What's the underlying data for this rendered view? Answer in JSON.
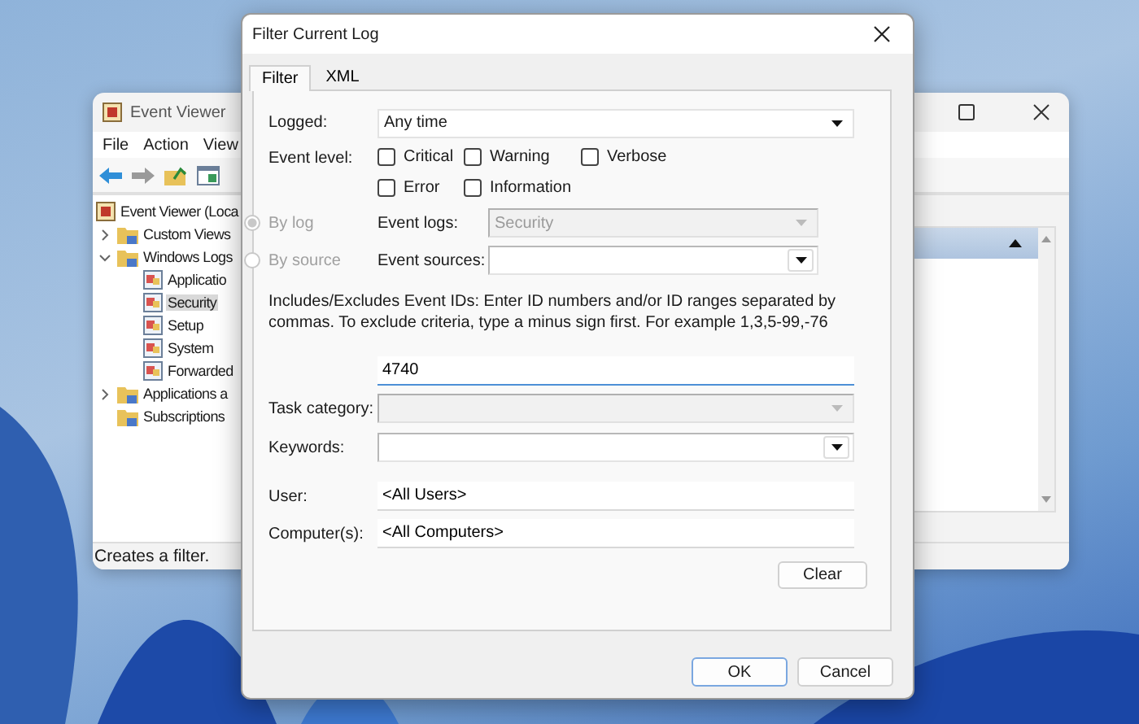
{
  "event_viewer": {
    "title": "Event Viewer",
    "menu": [
      {
        "label": "File"
      },
      {
        "label": "Action"
      },
      {
        "label": "View"
      }
    ],
    "tree": [
      {
        "label": "Event Viewer (Loca",
        "selected": false,
        "children": [
          {
            "label": "Custom Views",
            "selected": false,
            "expanded": false
          },
          {
            "label": "Windows Logs",
            "selected": false,
            "expanded": true,
            "children": [
              {
                "label": "Applicatio",
                "selected": false
              },
              {
                "label": "Security",
                "selected": true
              },
              {
                "label": "Setup",
                "selected": false
              },
              {
                "label": "System",
                "selected": false
              },
              {
                "label": "Forwarded",
                "selected": false
              }
            ]
          },
          {
            "label": "Applications a",
            "selected": false,
            "expanded": false
          },
          {
            "label": "Subscriptions",
            "selected": false
          }
        ]
      }
    ],
    "status_bar": "Creates a filter."
  },
  "dialog": {
    "title": "Filter Current Log",
    "tabs": [
      {
        "label": "Filter",
        "selected": true
      },
      {
        "label": "XML",
        "selected": false
      }
    ],
    "logged": {
      "label": "Logged:",
      "value": "Any time",
      "disabled": false
    },
    "event_level": {
      "label": "Event level:",
      "options": [
        {
          "label": "Critical",
          "checked": false
        },
        {
          "label": "Warning",
          "checked": false
        },
        {
          "label": "Verbose",
          "checked": false
        },
        {
          "label": "Error",
          "checked": false
        },
        {
          "label": "Information",
          "checked": false
        }
      ]
    },
    "source_mode": [
      {
        "label": "By log",
        "selected": true,
        "disabled": true,
        "field": {
          "label": "Event logs:",
          "value": "Security",
          "disabled": true
        }
      },
      {
        "label": "By source",
        "selected": false,
        "disabled": true,
        "field": {
          "label": "Event sources:",
          "disabled": false
        }
      }
    ],
    "event_ids": {
      "description": "Includes/Excludes Event IDs: Enter ID numbers and/or ID ranges separated by commas. To exclude criteria, type a minus sign first. For example 1,3,5-99,-76",
      "value": "4740"
    },
    "task_category": {
      "label": "Task category:",
      "disabled": true
    },
    "keywords": {
      "label": "Keywords:",
      "disabled": false
    },
    "user": {
      "label": "User:",
      "value": "<All Users>"
    },
    "computers": {
      "label": "Computer(s):",
      "value": "<All Computers>"
    },
    "clear_button": "Clear",
    "buttons": [
      {
        "label": "OK",
        "default": true
      },
      {
        "label": "Cancel",
        "default": false
      }
    ]
  }
}
